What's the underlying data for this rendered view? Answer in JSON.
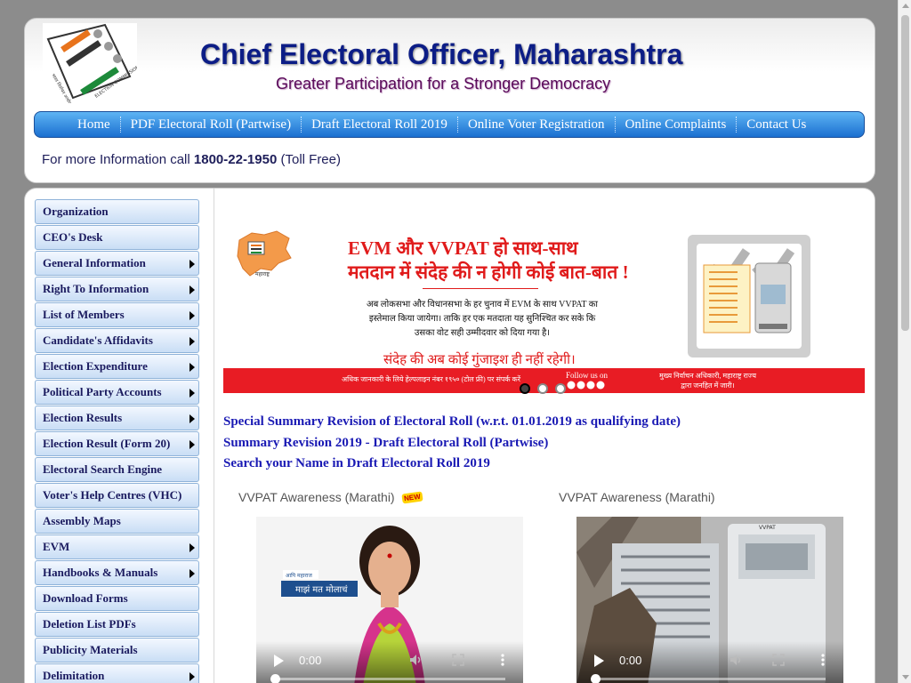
{
  "header": {
    "title": "Chief Electoral Officer, Maharashtra",
    "tagline": "Greater Participation for a Stronger Democracy",
    "nav": [
      "Home",
      "PDF Electoral Roll (Partwise)",
      "Draft Electoral Roll 2019",
      "Online Voter Registration",
      "Online Complaints",
      "Contact Us"
    ],
    "info_prefix": "For more Information call ",
    "info_number": "1800-22-1950",
    "info_suffix": " (Toll Free)"
  },
  "sidebar": {
    "items": [
      {
        "label": "Organization",
        "submenu": false
      },
      {
        "label": "CEO's Desk",
        "submenu": false
      },
      {
        "label": "General Information",
        "submenu": true
      },
      {
        "label": "Right To Information",
        "submenu": true
      },
      {
        "label": "List of Members",
        "submenu": true
      },
      {
        "label": "Candidate's Affidavits",
        "submenu": true
      },
      {
        "label": "Election Expenditure",
        "submenu": true
      },
      {
        "label": "Political Party Accounts",
        "submenu": true
      },
      {
        "label": "Election Results",
        "submenu": true
      },
      {
        "label": "Election Result (Form 20)",
        "submenu": true
      },
      {
        "label": "Electoral Search Engine",
        "submenu": false
      },
      {
        "label": "Voter's Help Centres (VHC)",
        "submenu": false
      },
      {
        "label": "Assembly Maps",
        "submenu": false
      },
      {
        "label": "EVM",
        "submenu": true
      },
      {
        "label": "Handbooks & Manuals",
        "submenu": true
      },
      {
        "label": "Download Forms",
        "submenu": false
      },
      {
        "label": "Deletion List PDFs",
        "submenu": false
      },
      {
        "label": "Publicity Materials",
        "submenu": false
      },
      {
        "label": "Delimitation",
        "submenu": true
      }
    ]
  },
  "banner": {
    "headline1": "EVM और VVPAT हो साथ-साथ",
    "headline2": "मतदान में संदेह की न होगी कोई बात-बात !",
    "body": "अब लोकसभा और विधानसभा के हर चुनाव में EVM के साथ VVPAT का इस्तेमाल किया जायेगा। ताकि हर एक मतदाता यह सुनिश्चित कर सके कि उसका वोट सही उम्मीदवार को दिया गया है।",
    "footer": "संदेह की अब कोई गुंजाइश ही नहीं रहेगी।",
    "strip_left": "अधिक जानकारी के लिये हेल्पलाइन नंबर १९५० (टोल फ्री) पर संपर्क करें",
    "strip_follow": "Follow us on",
    "strip_right_1": "मुख्य निर्वाचन अधिकारी, महाराष्ट्र राज्य",
    "strip_right_2": "द्वारा जनहित में जारी।",
    "map_label": "महाराष्ट्र",
    "slides": 3,
    "active_slide": 1
  },
  "links": [
    "Special Summary Revision of Electoral Roll (w.r.t. 01.01.2019 as qualifying date)",
    "Summary Revision 2019 - Draft Electoral Roll (Partwise)",
    "Search your Name in Draft Electoral Roll 2019"
  ],
  "videos": [
    {
      "title": "VVPAT Awareness (Marathi)",
      "badge": "NEW",
      "time": "0:00",
      "caption_top": "आपि महाराज",
      "caption_main": "माझं मत मोलाचं"
    },
    {
      "title": "VVPAT Awareness (Marathi)",
      "badge": "",
      "time": "0:00",
      "machine_label": "VVPAT"
    }
  ],
  "colors": {
    "title": "#0c1d86",
    "nav_bg": "#1b6fd0",
    "link": "#1a1ab4",
    "banner_red": "#e81c24"
  }
}
